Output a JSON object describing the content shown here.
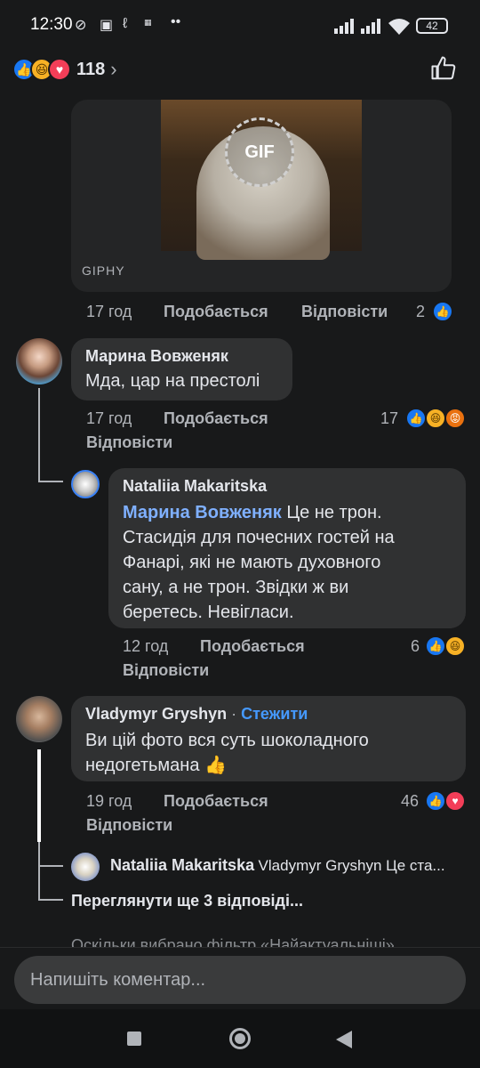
{
  "status_bar": {
    "time": "12:30",
    "battery": "42"
  },
  "header": {
    "reaction_count": "118"
  },
  "gif": {
    "badge": "GIF",
    "source": "GIPHY"
  },
  "comment_gif": {
    "time": "17 год",
    "like_label": "Подобається",
    "reply_label": "Відповісти",
    "reaction_count": "2"
  },
  "comment_marina": {
    "author": "Марина Вовженяк",
    "text": "Мда, цар на престолі",
    "time": "17 год",
    "like_label": "Подобається",
    "reply_label": "Відповісти",
    "reaction_count": "17"
  },
  "reply_nataliia": {
    "author": "Nataliia Makaritska",
    "mention": "Марина Вовженяк",
    "line1": " Це не трон.",
    "line2": "Стасидія для почесних гостей на",
    "line3": "Фанарі, які не мають духовного",
    "line4": "сану, а не трон. Звідки ж ви",
    "line5": "беретесь. Невігласи.",
    "time": "12 год",
    "like_label": "Подобається",
    "reply_label": "Відповісти",
    "reaction_count": "6"
  },
  "comment_vladymyr": {
    "author": "Vladymyr Gryshyn",
    "separator": " · ",
    "follow_label": "Стежити",
    "line1": "Ви цій фото вся суть шоколадного",
    "line2": "недогетьмана",
    "emoji": "👍",
    "time": "19 год",
    "like_label": "Подобається",
    "reply_label": "Відповісти",
    "reaction_count": "46"
  },
  "reply_preview": {
    "author": "Nataliia Makaritska",
    "snippet": "Vladymyr Gryshyn Це ста..."
  },
  "more_replies": "Переглянути ще 3 відповіді...",
  "filter_notice": "Оскільки вибрано фільтр «Найактуальніші»",
  "composer": {
    "placeholder": "Напишіть коментар..."
  },
  "colors": {
    "background": "#18191a",
    "bubble": "#303132",
    "link_blue": "#4599ff",
    "mention_blue": "#7fb0ff"
  }
}
